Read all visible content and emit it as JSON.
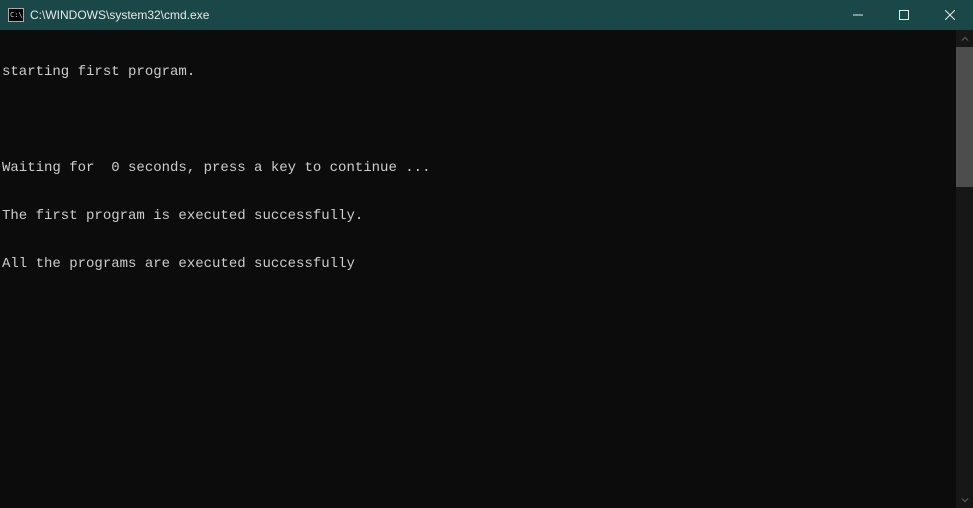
{
  "titlebar": {
    "icon_text": "C:\\",
    "title": "C:\\WINDOWS\\system32\\cmd.exe"
  },
  "terminal": {
    "lines": [
      "starting first program.",
      "",
      "Waiting for  0 seconds, press a key to continue ...",
      "The first program is executed successfully.",
      "All the programs are executed successfully"
    ]
  }
}
